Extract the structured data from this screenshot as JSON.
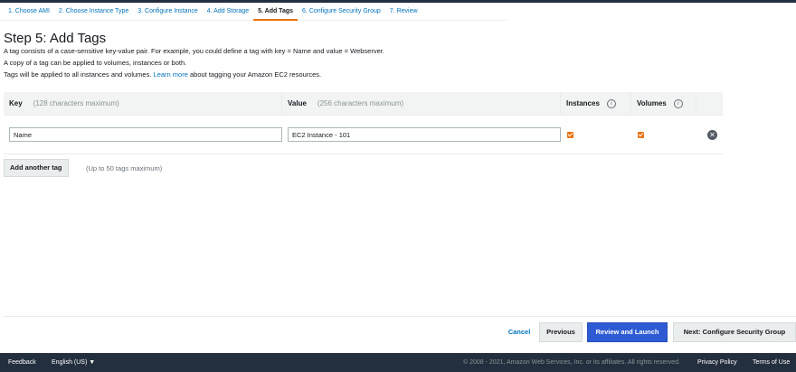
{
  "wizard": {
    "steps": [
      "1. Choose AMI",
      "2. Choose Instance Type",
      "3. Configure Instance",
      "4. Add Storage",
      "5. Add Tags",
      "6. Configure Security Group",
      "7. Review"
    ],
    "active_index": 4
  },
  "page": {
    "title": "Step 5: Add Tags",
    "desc_line1": "A tag consists of a case-sensitive key-value pair. For example, you could define a tag with key = Name and value = Webserver.",
    "desc_line2": "A copy of a tag can be applied to volumes, instances or both.",
    "desc_line3_pre": "Tags will be applied to all instances and volumes.",
    "desc_line3_link": "Learn more",
    "desc_line3_post": "about tagging your Amazon EC2 resources."
  },
  "table": {
    "headers": {
      "key": "Key",
      "key_hint": "(128 characters maximum)",
      "value": "Value",
      "value_hint": "(256 characters maximum)",
      "instances": "Instances",
      "volumes": "Volumes",
      "info_glyph": "i"
    },
    "rows": [
      {
        "key": "Name",
        "value": "EC2 Instance - 101",
        "instances": true,
        "volumes": true
      }
    ],
    "remove_glyph": "✕"
  },
  "add_tag": {
    "button_label": "Add another tag",
    "hint": "(Up to 50 tags maximum)"
  },
  "actions": {
    "cancel": "Cancel",
    "previous": "Previous",
    "review_launch": "Review and Launch",
    "next": "Next: Configure Security Group"
  },
  "footer": {
    "feedback": "Feedback",
    "language": "English (US) ▼",
    "copyright": "© 2008 - 2021, Amazon Web Services, Inc. or its affiliates. All rights reserved.",
    "privacy": "Privacy Policy",
    "terms": "Terms of Use"
  },
  "colors": {
    "accent": "#ec7211",
    "link": "#0073bb",
    "primary_button": "#2e5bd4",
    "nav_bg": "#232f3e"
  }
}
